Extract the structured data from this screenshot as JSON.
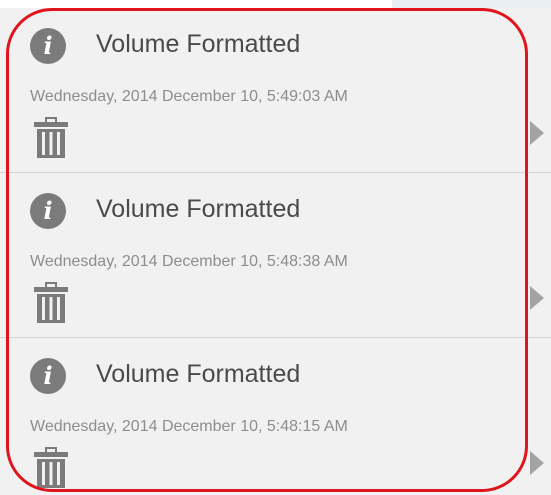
{
  "notifications": [
    {
      "icon": "info-icon",
      "title": "Volume Formatted",
      "timestamp": "Wednesday, 2014 December 10, 5:49:03 AM",
      "action_icon": "trash-icon",
      "expand_icon": "chevron-right-icon"
    },
    {
      "icon": "info-icon",
      "title": "Volume Formatted",
      "timestamp": "Wednesday, 2014 December 10, 5:48:38 AM",
      "action_icon": "trash-icon",
      "expand_icon": "chevron-right-icon"
    },
    {
      "icon": "info-icon",
      "title": "Volume Formatted",
      "timestamp": "Wednesday, 2014 December 10, 5:48:15 AM",
      "action_icon": "trash-icon",
      "expand_icon": "chevron-right-icon"
    }
  ],
  "colors": {
    "panel_background": "#f1f1f1",
    "icon_gray": "#7b7b7b",
    "title_text": "#4a4a4a",
    "timestamp_text": "#8d8d8d",
    "divider": "#d4d4d4",
    "highlight_outline": "#e0141c"
  }
}
